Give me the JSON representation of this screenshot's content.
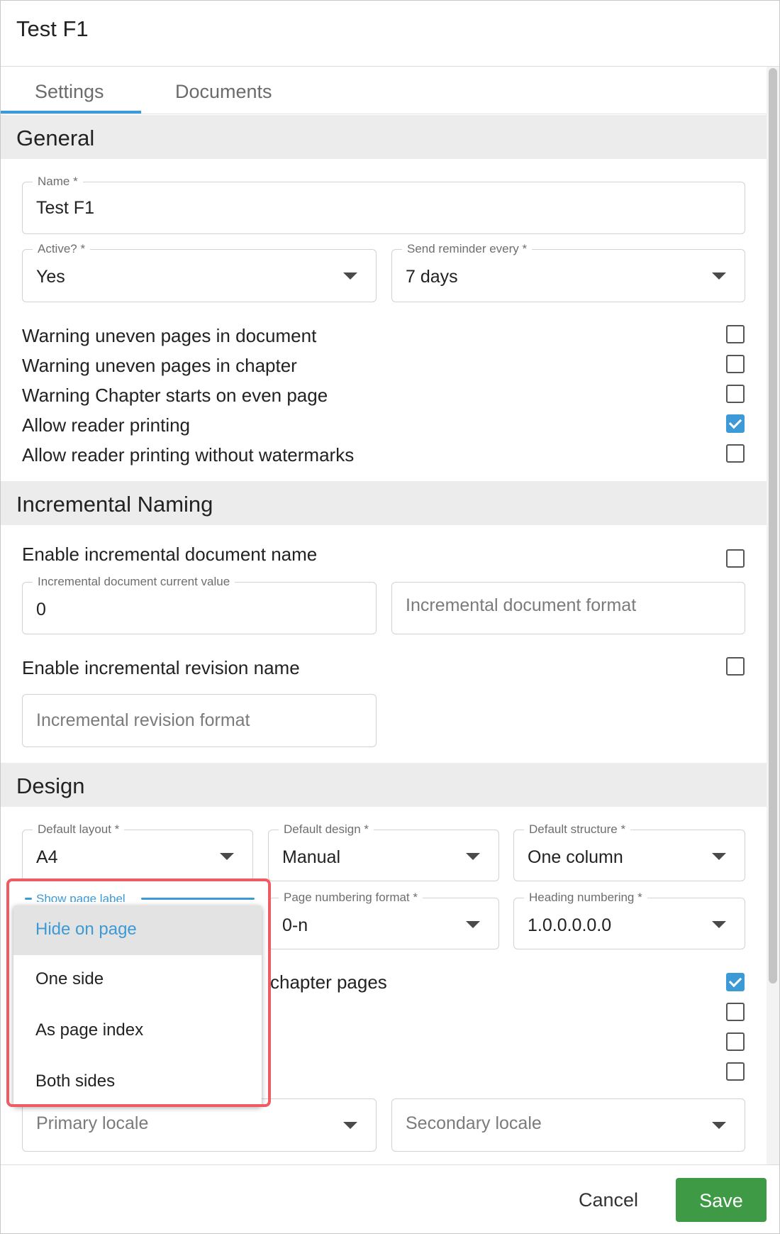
{
  "dialog": {
    "title": "Test F1"
  },
  "tabs": [
    {
      "label": "Settings",
      "active": true
    },
    {
      "label": "Documents",
      "active": false
    }
  ],
  "general": {
    "header": "General",
    "name": {
      "label": "Name *",
      "value": "Test F1"
    },
    "active": {
      "label": "Active? *",
      "value": "Yes"
    },
    "reminder": {
      "label": "Send reminder every *",
      "value": "7 days"
    },
    "checks": [
      {
        "label": "Warning uneven pages in document",
        "checked": false
      },
      {
        "label": "Warning uneven pages in chapter",
        "checked": false
      },
      {
        "label": "Warning Chapter starts on even page",
        "checked": false
      },
      {
        "label": "Allow reader printing",
        "checked": true
      },
      {
        "label": "Allow reader printing without watermarks",
        "checked": false
      }
    ]
  },
  "incremental": {
    "header": "Incremental Naming",
    "doc_name": {
      "label": "Enable incremental document name",
      "checked": false
    },
    "doc_current": {
      "label": "Incremental document current value",
      "value": "0"
    },
    "doc_format": {
      "placeholder": "Incremental document format"
    },
    "rev_name": {
      "label": "Enable incremental revision name",
      "checked": false
    },
    "rev_format": {
      "placeholder": "Incremental revision format"
    }
  },
  "design": {
    "header": "Design",
    "layout": {
      "label": "Default layout *",
      "value": "A4"
    },
    "design": {
      "label": "Default design *",
      "value": "Manual"
    },
    "structure": {
      "label": "Default structure *",
      "value": "One column"
    },
    "page_label": {
      "label": "Show page label"
    },
    "page_numbering": {
      "label": "Page numbering format *",
      "value": "0-n"
    },
    "heading_numbering": {
      "label": "Heading numbering *",
      "value": "1.0.0.0.0.0"
    },
    "partial_check_text": "chapter pages",
    "checks": [
      true,
      false,
      false,
      false
    ],
    "primary_locale": {
      "placeholder": "Primary locale"
    },
    "secondary_locale": {
      "placeholder": "Secondary locale"
    }
  },
  "dropdown": {
    "options": [
      {
        "label": "Hide on page",
        "selected": true
      },
      {
        "label": "One side",
        "selected": false
      },
      {
        "label": "As page index",
        "selected": false
      },
      {
        "label": "Both sides",
        "selected": false
      }
    ]
  },
  "footer": {
    "cancel": "Cancel",
    "save": "Save"
  },
  "colors": {
    "accent": "#3c9ad6",
    "save": "#3f9a46",
    "highlight": "#ef5b62"
  }
}
